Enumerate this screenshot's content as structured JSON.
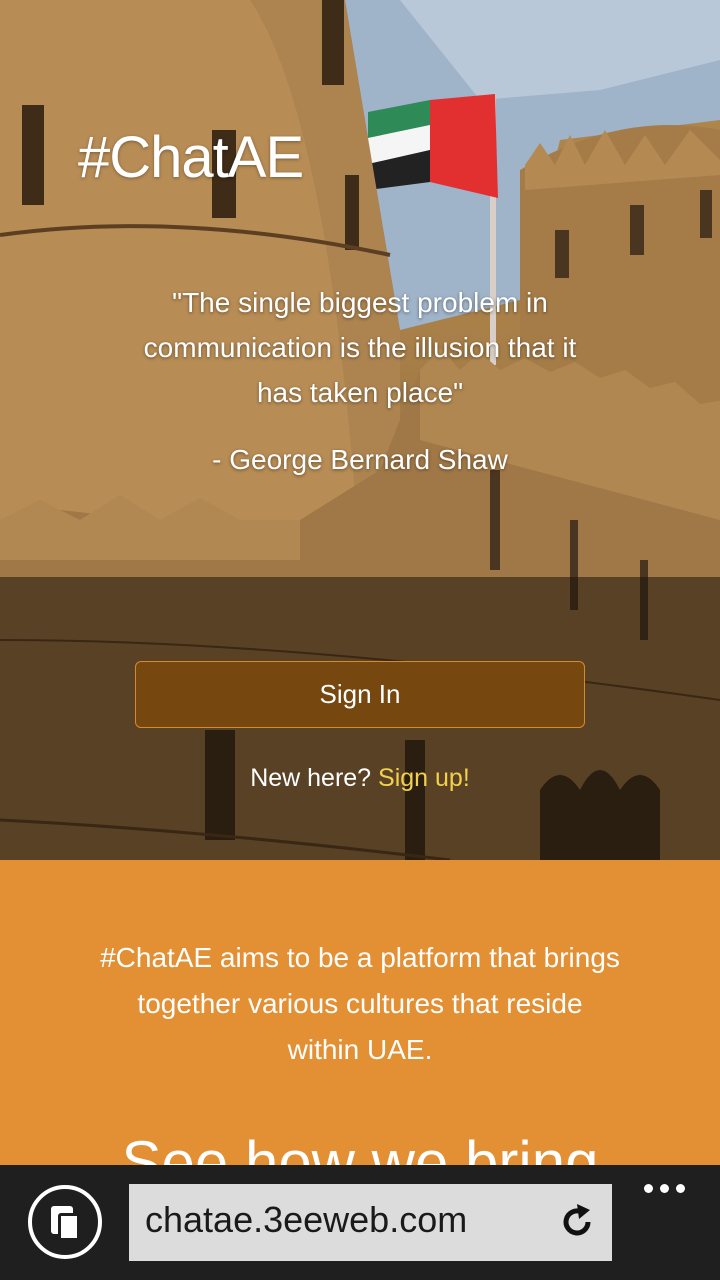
{
  "hero": {
    "title": "#ChatAE",
    "quote_lines": [
      "\"The single biggest problem in",
      "communication is the illusion that it",
      "has taken place\""
    ],
    "quote_author": "- George Bernard Shaw"
  },
  "auth": {
    "signin_label": "Sign In",
    "new_here_text": "New here? ",
    "signup_label": "Sign up!"
  },
  "about": {
    "lines": [
      "#ChatAE aims to be a platform that brings",
      "together various cultures that reside",
      "within UAE."
    ],
    "heading": "See how we bring"
  },
  "browser": {
    "url": "chatae.3eeweb.com"
  },
  "colors": {
    "accent_orange": "#e38f34",
    "signin_button": "#774710",
    "signup_link": "#f2d04e"
  },
  "icons": {
    "tabs": "tabs-icon",
    "refresh": "refresh-icon",
    "more": "more-icon",
    "flag": "uae-flag"
  }
}
